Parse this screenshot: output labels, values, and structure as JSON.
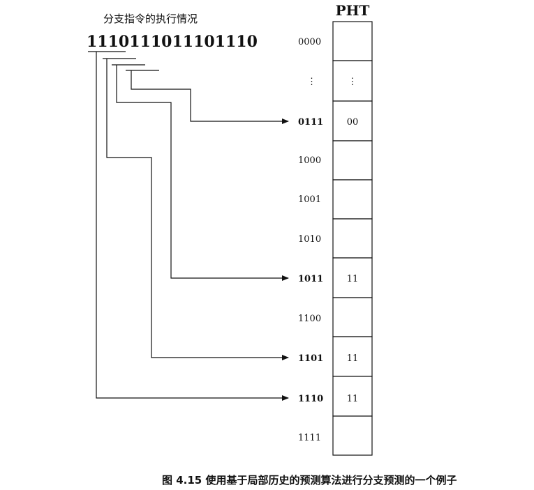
{
  "header_label": "分支指令的执行情况",
  "history_bits": "1110111011101110",
  "table_title": "PHT",
  "rows": [
    {
      "addr": "0000",
      "value": "",
      "bold": false
    },
    {
      "addr": "⋮",
      "value": "⋮",
      "bold": false
    },
    {
      "addr": "0111",
      "value": "00",
      "bold": true
    },
    {
      "addr": "1000",
      "value": "",
      "bold": false
    },
    {
      "addr": "1001",
      "value": "",
      "bold": false
    },
    {
      "addr": "1010",
      "value": "",
      "bold": false
    },
    {
      "addr": "1011",
      "value": "11",
      "bold": true
    },
    {
      "addr": "1100",
      "value": "",
      "bold": false
    },
    {
      "addr": "1101",
      "value": "11",
      "bold": true
    },
    {
      "addr": "1110",
      "value": "11",
      "bold": true
    },
    {
      "addr": "1111",
      "value": "",
      "bold": false
    }
  ],
  "caption": "图 4.15   使用基于局部历史的预测算法进行分支预测的一个例子"
}
